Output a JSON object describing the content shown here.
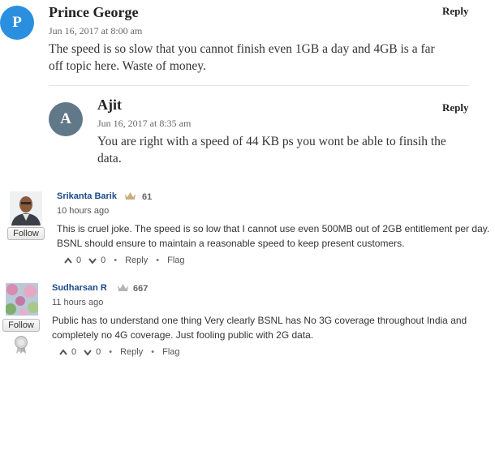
{
  "comments": [
    {
      "avatar_letter": "P",
      "avatar_color": "#2b8fe0",
      "author": "Prince George",
      "date": "Jun 16, 2017 at 8:00 am",
      "text_line1": "The speed is so slow that you cannot finish even 1GB a day and 4GB is a far",
      "text_line2": "off topic here. Waste of money.",
      "reply_label": "Reply"
    },
    {
      "avatar_letter": "A",
      "avatar_color": "#607887",
      "author": "Ajit",
      "date": "Jun 16, 2017 at 8:35 am",
      "text_line1": "You are right with a speed of 44 KB ps you wont be able to finsih the",
      "text_line2": "data.",
      "reply_label": "Reply"
    }
  ],
  "reader_comments": [
    {
      "author": "Srikanta Barik",
      "score": "61",
      "time": "10 hours ago",
      "text_line1": "This is cruel joke. The speed is so low that I cannot use even 500MB out of 2GB entitlement per day.",
      "text_line2": "BSNL should ensure to maintain a reasonable speed to keep present customers.",
      "upvotes": "0",
      "downvotes": "0",
      "reply_label": "Reply",
      "flag_label": "Flag",
      "follow_label": "Follow",
      "bullet": "•"
    },
    {
      "author": "Sudharsan R",
      "score": "667",
      "time": "11 hours ago",
      "text_line1": "Public has to understand one thing Very clearly BSNL has No 3G coverage throughout India and",
      "text_line2": "completely no 4G coverage. Just fooling public with 2G data.",
      "upvotes": "0",
      "downvotes": "0",
      "reply_label": "Reply",
      "flag_label": "Flag",
      "follow_label": "Follow",
      "bullet": "•"
    }
  ],
  "colors": {
    "crown": "#c8ad7f",
    "crown_grey": "#b5b5b5",
    "name_link": "#1a4a8a"
  }
}
